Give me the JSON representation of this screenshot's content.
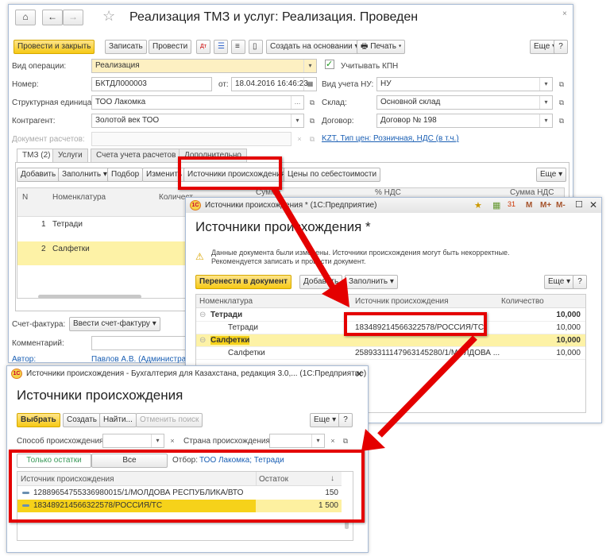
{
  "main": {
    "title": "Реализация ТМЗ и услуг: Реализация. Проведен",
    "toolbar": {
      "post_close": "Провести и закрыть",
      "save": "Записать",
      "post": "Провести",
      "create_based": "Создать на основании",
      "print": "Печать",
      "more": "Еще",
      "help": "?"
    },
    "form": {
      "op_label": "Вид операции:",
      "op_value": "Реализация",
      "kpn_label": "Учитывать КПН",
      "kpn_checked": true,
      "num_label": "Номер:",
      "num_value": "БКТДЛ000003",
      "date_label": "от:",
      "date_value": "18.04.2016 16:46:23",
      "nu_label": "Вид учета НУ:",
      "nu_value": "НУ",
      "unit_label": "Структурная единица:",
      "unit_value": "ТОО Лакомка",
      "wh_label": "Склад:",
      "wh_value": "Основной склад",
      "ctr_label": "Контрагент:",
      "ctr_value": "Золотой век ТОО",
      "contract_label": "Договор:",
      "contract_value": "Договор № 198",
      "docpay_label": "Документ расчетов:",
      "docpay_value": "",
      "price_link": "KZT, Тип цен: Розничная, НДС (в т.ч.)"
    },
    "tabs": [
      "ТМЗ (2)",
      "Услуги",
      "Счета учета расчетов",
      "Дополнительно"
    ],
    "tab_toolbar": {
      "add": "Добавить",
      "fill": "Заполнить",
      "pick": "Подбор",
      "change": "Изменить",
      "sources": "Источники происхождения",
      "cost_prices": "Цены по себестоимости",
      "more": "Еще"
    },
    "table": {
      "headers": [
        "N",
        "Номенклатура",
        "Количест",
        "Сумма",
        "% НДС",
        "Сумма НДС"
      ],
      "rows": [
        {
          "n": "1",
          "name": "Тетради"
        },
        {
          "n": "2",
          "name": "Салфетки"
        }
      ]
    },
    "invoice_label": "Счет-фактура:",
    "invoice_btn": "Ввести счет-фактуру",
    "comment_label": "Комментарий:",
    "comment_value": "",
    "author_label": "Автор:",
    "author_value": "Павлов А.В. (Администратор)"
  },
  "sources_doc": {
    "window_title": "Источники происхождения * (1С:Предприятие)",
    "title_buttons": [
      "M",
      "M+",
      "M-"
    ],
    "heading": "Источники происхождения *",
    "warning": "Данные документа были изменены. Источники происхождения могут быть некорректные.",
    "warning2": "Рекомендуется записать и провести документ.",
    "toolbar": {
      "transfer": "Перенести в документ",
      "add": "Добавить",
      "fill": "Заполнить",
      "more": "Еще",
      "help": "?"
    },
    "headers": [
      "Номенклатура",
      "Источник происхождения",
      "Количество"
    ],
    "rows": [
      {
        "name": "Тетради",
        "source": "",
        "qty": "10,000",
        "group": true
      },
      {
        "name": "Тетради",
        "source": "183489214566322578/РОССИЯ/ТС",
        "qty": "10,000",
        "group": false
      },
      {
        "name": "Салфетки",
        "source": "",
        "qty": "10,000",
        "group": true
      },
      {
        "name": "Салфетки",
        "source": "258933111479631452​80/1/МОЛДОВА ...",
        "qty": "10,000",
        "group": false
      }
    ]
  },
  "sources_list": {
    "window_title": "Источники происхождения - Бухгалтерия для Казахстана, редакция 3.0,... (1С:Предприятие)",
    "heading": "Источники происхождения",
    "toolbar": {
      "select": "Выбрать",
      "create": "Создать",
      "find": "Найти...",
      "cancel_search": "Отменить поиск",
      "more": "Еще",
      "help": "?"
    },
    "method_label": "Способ происхождения:",
    "method_value": "",
    "country_label": "Страна происхождения:",
    "country_value": "",
    "filter_tabs": [
      "Только остатки",
      "Все"
    ],
    "filter_label": "Отбор:",
    "filter_value": "ТОО Лакомка; Тетради",
    "headers": [
      "Источник происхождения",
      "Остаток"
    ],
    "rows": [
      {
        "source": "128896547553369800​15/1/МОЛДОВА РЕСПУБЛИКА/ВТО",
        "balance": "150"
      },
      {
        "source": "183489214566322578/РОССИЯ/ТС",
        "balance": "1 500",
        "selected": true
      }
    ]
  },
  "colors": {
    "accent_yellow": "#f6c915",
    "highlight_row": "#fdf2a6",
    "annotation_red": "#e40000",
    "link": "#1a5fb4"
  }
}
